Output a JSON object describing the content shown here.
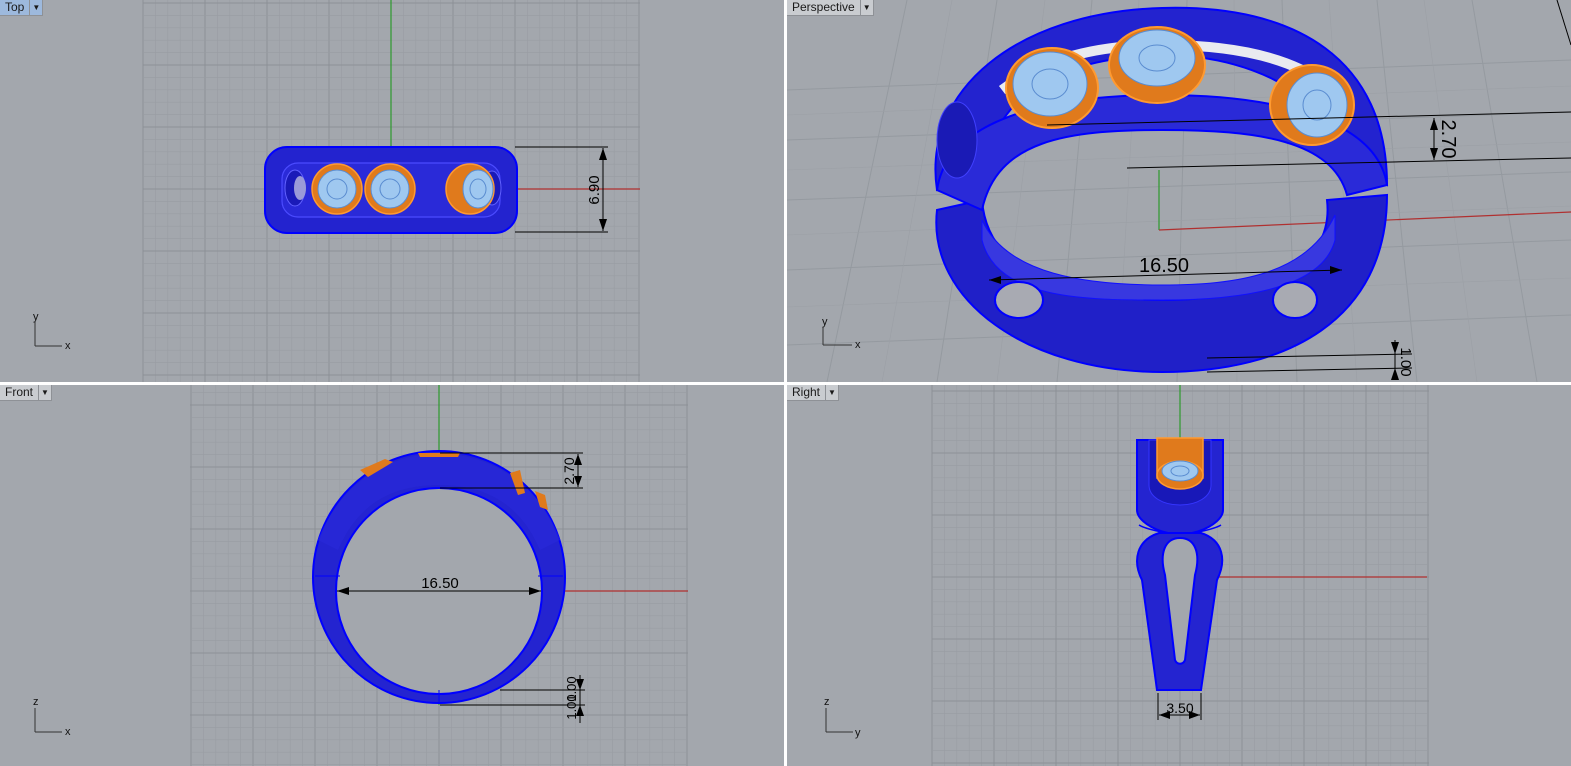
{
  "viewports": {
    "top": {
      "title": "Top",
      "active": true,
      "dims": {
        "width": "6.90"
      },
      "axes": [
        "y",
        "x"
      ]
    },
    "perspective": {
      "title": "Perspective",
      "active": false,
      "dims": {
        "inner": "16.50",
        "height": "2.70",
        "thickness": "1.00"
      },
      "axes": [
        "y",
        "x"
      ]
    },
    "front": {
      "title": "Front",
      "active": false,
      "dims": {
        "inner": "16.50",
        "height": "2.70",
        "thickness_a": "1.00",
        "thickness_b": "1.00"
      },
      "axes": [
        "z",
        "x"
      ]
    },
    "right": {
      "title": "Right",
      "active": false,
      "dims": {
        "width": "3.50"
      },
      "axes": [
        "z",
        "y"
      ]
    }
  },
  "colors": {
    "background": "#a3a7ad",
    "grid_minor": "#999da3",
    "grid_major": "#8a8e94",
    "band": "#2424d0",
    "band_edge": "#0000ff",
    "bezel": "#e07a1c",
    "gem": "#9fc8f0",
    "axis_x": "#b03030",
    "axis_y": "#2e9a2e"
  },
  "icons": [
    "dropdown-arrow-icon",
    "axis-widget-icon"
  ]
}
